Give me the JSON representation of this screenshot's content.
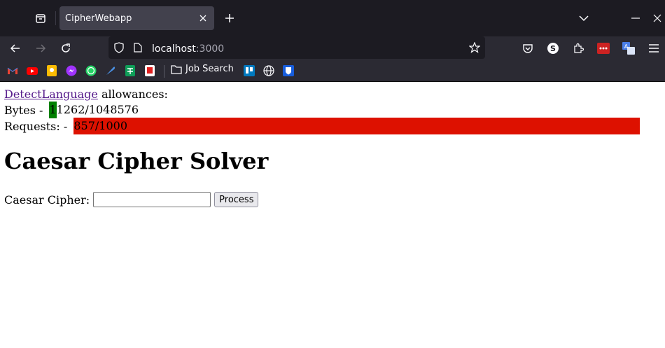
{
  "browser": {
    "tab_title": "CipherWebapp",
    "url_host": "localhost",
    "url_port": ":3000",
    "bookmark_folder": "Job Search",
    "accent": "#1c1b22"
  },
  "page": {
    "link_text": "DetectLanguage",
    "allowances_text": " allowances:",
    "bytes_label": "Bytes - ",
    "bytes_text": "11262/1048576",
    "bytes_used": 11262,
    "bytes_limit": 1048576,
    "bytes_color": "#008000",
    "requests_label": "Requests: - ",
    "requests_text": "857/1000",
    "requests_used": 857,
    "requests_limit": 1000,
    "requests_color": "#dd1100",
    "heading": "Caesar Cipher Solver",
    "cipher_label": "Caesar Cipher:",
    "cipher_value": "",
    "process_label": "Process"
  }
}
